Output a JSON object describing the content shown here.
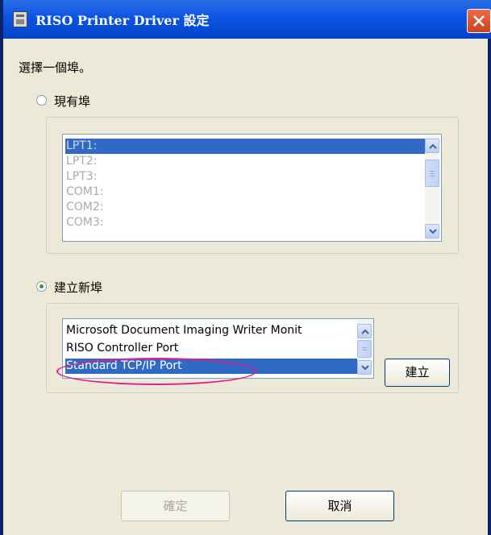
{
  "window": {
    "title": "RISO Printer Driver 設定"
  },
  "prompt": "選擇一個埠。",
  "existing_port": {
    "label": "現有埠",
    "selected": false,
    "items": [
      "LPT1:",
      "LPT2:",
      "LPT3:",
      "COM1:",
      "COM2:",
      "COM3:"
    ],
    "selected_item": "LPT1:"
  },
  "new_port": {
    "label": "建立新埠",
    "selected": true,
    "items": [
      "Microsoft Document Imaging Writer Monit",
      "RISO Controller Port",
      "Standard TCP/IP Port"
    ],
    "selected_item": "Standard TCP/IP Port",
    "create_button": "建立"
  },
  "buttons": {
    "ok": "確定",
    "cancel": "取消"
  },
  "colors": {
    "titlebar": "#0a54e4",
    "selection": "#316ac5",
    "annotation": "#e01d8b"
  }
}
